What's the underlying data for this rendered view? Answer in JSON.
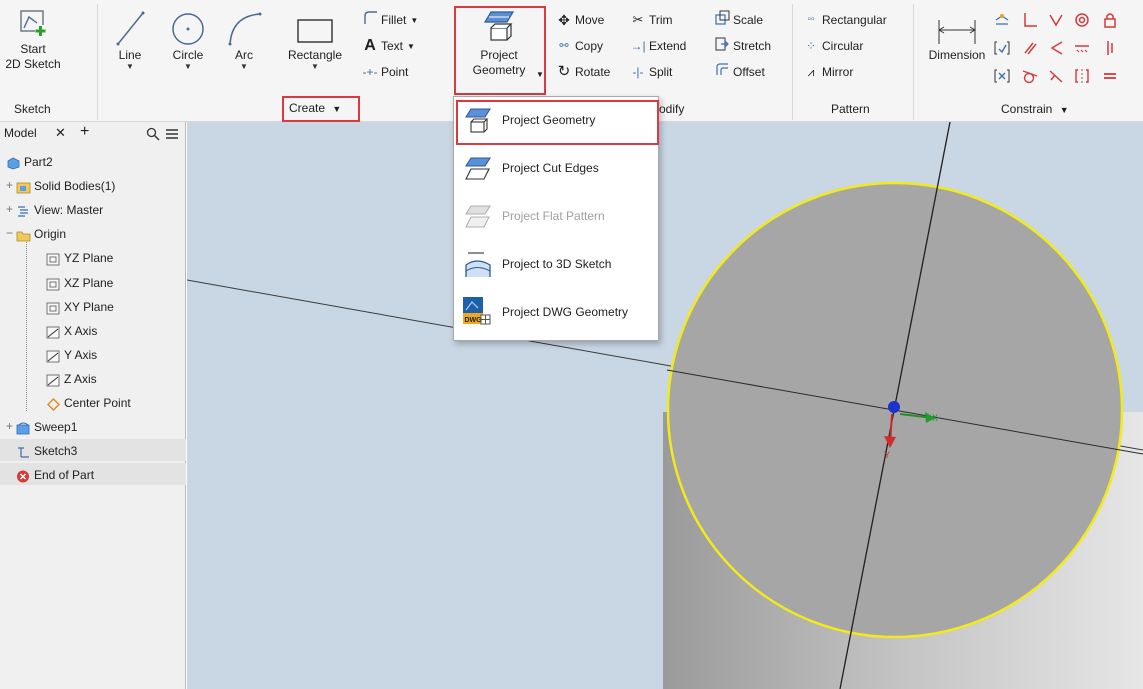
{
  "ribbon": {
    "sketch": {
      "start_2d_sketch_line1": "Start",
      "start_2d_sketch_line2": "2D Sketch",
      "panel_label": "Sketch"
    },
    "create": {
      "line": "Line",
      "circle": "Circle",
      "arc": "Arc",
      "rectangle": "Rectangle",
      "fillet": "Fillet",
      "text": "Text",
      "point": "Point",
      "project_geometry_line1": "Project",
      "project_geometry_line2": "Geometry",
      "panel_label": "Create"
    },
    "modify": {
      "move": "Move",
      "copy": "Copy",
      "rotate": "Rotate",
      "trim": "Trim",
      "extend": "Extend",
      "split": "Split",
      "scale": "Scale",
      "stretch": "Stretch",
      "offset": "Offset",
      "panel_label_partial": "odify"
    },
    "pattern": {
      "rectangular": "Rectangular",
      "circular": "Circular",
      "mirror": "Mirror",
      "panel_label": "Pattern"
    },
    "constrain": {
      "dimension": "Dimension",
      "panel_label": "Constrain"
    }
  },
  "dropdown": {
    "items": [
      {
        "label": "Project Geometry",
        "icon": "project-geometry-icon",
        "enabled": true
      },
      {
        "label": "Project Cut Edges",
        "icon": "project-cut-edges-icon",
        "enabled": true
      },
      {
        "label": "Project Flat Pattern",
        "icon": "project-flat-pattern-icon",
        "enabled": false
      },
      {
        "label": "Project to 3D Sketch",
        "icon": "project-to-3d-sketch-icon",
        "enabled": true
      },
      {
        "label": "Project DWG Geometry",
        "icon": "project-dwg-geometry-icon",
        "enabled": true
      }
    ],
    "dwg_badge": "DWG"
  },
  "browser": {
    "tab_label": "Model",
    "close_glyph": "✕",
    "add_glyph": "+",
    "tree": [
      {
        "label": "Part2",
        "icon": "part-icon",
        "expander": ""
      },
      {
        "label": "Solid Bodies(1)",
        "icon": "solid-bodies-icon",
        "expander": "+"
      },
      {
        "label": "View: Master",
        "icon": "view-icon",
        "expander": "+"
      },
      {
        "label": "Origin",
        "icon": "folder-icon",
        "expander": "−"
      },
      {
        "label": "YZ Plane",
        "icon": "plane-icon",
        "expander": ""
      },
      {
        "label": "XZ Plane",
        "icon": "plane-icon",
        "expander": ""
      },
      {
        "label": "XY Plane",
        "icon": "plane-icon",
        "expander": ""
      },
      {
        "label": "X Axis",
        "icon": "axis-icon",
        "expander": ""
      },
      {
        "label": "Y Axis",
        "icon": "axis-icon",
        "expander": ""
      },
      {
        "label": "Z Axis",
        "icon": "axis-icon",
        "expander": ""
      },
      {
        "label": "Center Point",
        "icon": "center-point-icon",
        "expander": ""
      },
      {
        "label": "Sweep1",
        "icon": "sweep-icon",
        "expander": "+"
      },
      {
        "label": "Sketch3",
        "icon": "sketch-icon",
        "expander": ""
      },
      {
        "label": "End of Part",
        "icon": "end-of-part-icon",
        "expander": ""
      }
    ]
  },
  "colors": {
    "highlight_red": "#d9393f",
    "viewport_bg": "#c9d6e4",
    "circle_yellow": "#f2ea1a",
    "disc_gray": "#a6a6a6"
  }
}
